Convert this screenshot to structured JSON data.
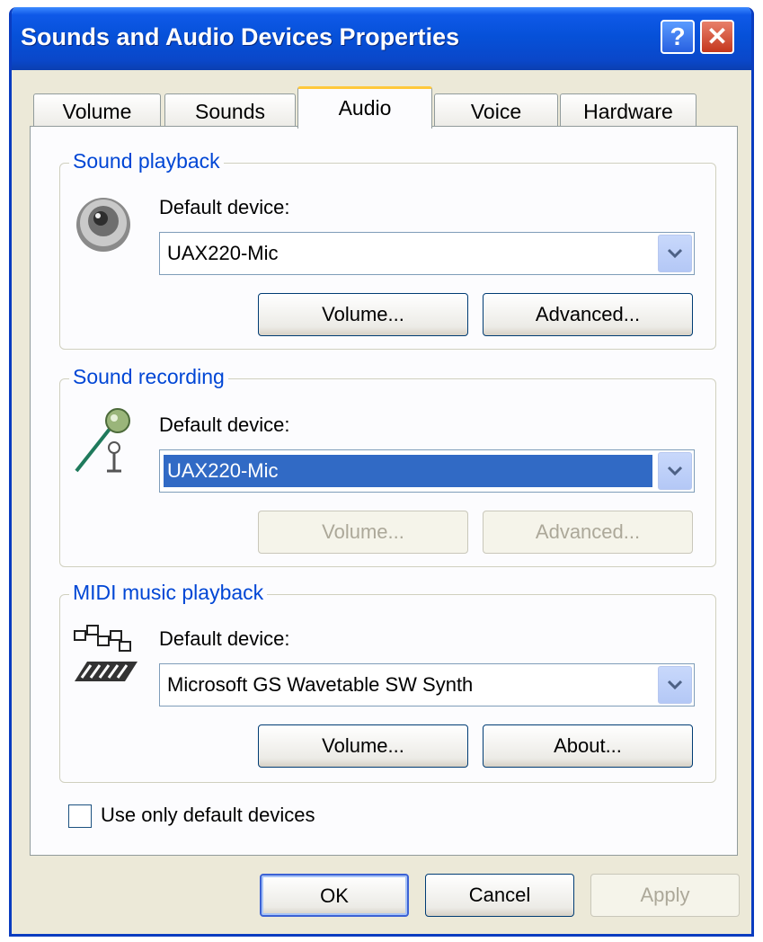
{
  "window": {
    "title": "Sounds and Audio Devices Properties",
    "help_glyph": "?",
    "close_glyph": "✕"
  },
  "tabs": [
    "Volume",
    "Sounds",
    "Audio",
    "Voice",
    "Hardware"
  ],
  "active_tab": "Audio",
  "groups": {
    "playback": {
      "title": "Sound playback",
      "label": "Default device:",
      "value": "UAX220-Mic",
      "buttons": [
        "Volume...",
        "Advanced..."
      ],
      "icon": "speaker-icon"
    },
    "recording": {
      "title": "Sound recording",
      "label": "Default device:",
      "value": "UAX220-Mic",
      "buttons": [
        "Volume...",
        "Advanced..."
      ],
      "icon": "microphone-icon"
    },
    "midi": {
      "title": "MIDI music playback",
      "label": "Default device:",
      "value": "Microsoft GS Wavetable SW Synth",
      "buttons": [
        "Volume...",
        "About..."
      ],
      "icon": "midi-keyboard-icon"
    }
  },
  "checkbox": {
    "label": "Use only default devices",
    "checked": false
  },
  "footer": {
    "ok": "OK",
    "cancel": "Cancel",
    "apply": "Apply"
  },
  "colors": {
    "title_bar": "#0651d9",
    "group_title": "#0046d5",
    "selection": "#316ac5",
    "active_tab_accent": "#ffc83c"
  }
}
